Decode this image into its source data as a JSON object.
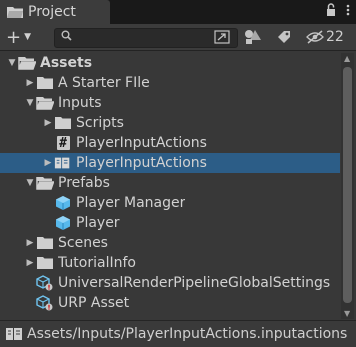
{
  "tab": {
    "title": "Project",
    "icon": "folder-icon"
  },
  "tab_actions": {
    "lock": "lock-icon",
    "menu": "kebab-menu-icon"
  },
  "toolbar": {
    "add_label": "+",
    "search": {
      "value": "",
      "placeholder": ""
    },
    "hidden_count": "22"
  },
  "tree": [
    {
      "label": "Assets",
      "depth": 0,
      "expand": "open",
      "icon": "folder-open",
      "bold": true,
      "selected": false
    },
    {
      "label": "A Starter FIle",
      "depth": 1,
      "expand": "closed",
      "icon": "folder",
      "bold": false,
      "selected": false
    },
    {
      "label": "Inputs",
      "depth": 1,
      "expand": "open",
      "icon": "folder-open",
      "bold": false,
      "selected": false
    },
    {
      "label": "Scripts",
      "depth": 2,
      "expand": "closed",
      "icon": "folder",
      "bold": false,
      "selected": false
    },
    {
      "label": "PlayerInputActions",
      "depth": 2,
      "expand": "none",
      "icon": "csharp-script",
      "bold": false,
      "selected": false
    },
    {
      "label": "PlayerInputActions",
      "depth": 2,
      "expand": "closed",
      "icon": "input-actions",
      "bold": false,
      "selected": true
    },
    {
      "label": "Prefabs",
      "depth": 1,
      "expand": "open",
      "icon": "folder-open",
      "bold": false,
      "selected": false
    },
    {
      "label": "Player Manager",
      "depth": 2,
      "expand": "none",
      "icon": "prefab",
      "bold": false,
      "selected": false
    },
    {
      "label": "Player",
      "depth": 2,
      "expand": "none",
      "icon": "prefab",
      "bold": false,
      "selected": false
    },
    {
      "label": "Scenes",
      "depth": 1,
      "expand": "closed",
      "icon": "folder",
      "bold": false,
      "selected": false
    },
    {
      "label": "TutorialInfo",
      "depth": 1,
      "expand": "closed",
      "icon": "folder",
      "bold": false,
      "selected": false
    },
    {
      "label": "UniversalRenderPipelineGlobalSettings",
      "depth": 1,
      "expand": "none",
      "icon": "render-settings",
      "bold": false,
      "selected": false
    },
    {
      "label": "URP Asset",
      "depth": 1,
      "expand": "none",
      "icon": "render-settings",
      "bold": false,
      "selected": false
    }
  ],
  "status_path": "Assets/Inputs/PlayerInputActions.inputactions",
  "colors": {
    "selection": "#2c5d87",
    "prefab": "#4fb3e8",
    "panel": "#383838"
  }
}
